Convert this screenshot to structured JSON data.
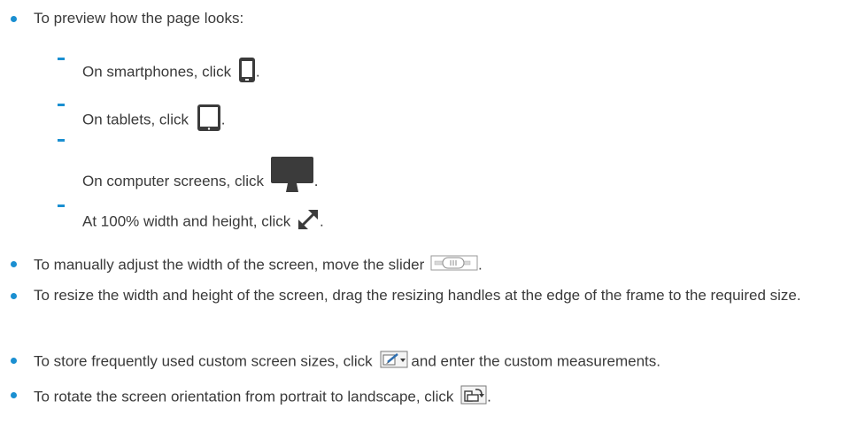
{
  "items": [
    {
      "text": "To preview how the page looks:"
    },
    {
      "text": "On smartphones, click",
      "suffix": ".",
      "icon": "smartphone-icon"
    },
    {
      "text": "On tablets, click",
      "suffix": ".",
      "icon": "tablet-icon"
    },
    {
      "text": "On computer screens, click",
      "suffix": ".",
      "icon": "desktop-monitor-icon"
    },
    {
      "text": "At 100% width and height, click",
      "suffix": ".",
      "icon": "expand-diagonal-icon"
    },
    {
      "text": "To manually adjust the width of the screen, move the slider",
      "suffix": ".",
      "icon": "slider-icon"
    },
    {
      "text": "To resize the width and height of the screen, drag the resizing handles at the edge of the frame to the required size."
    },
    {
      "text": "To store frequently used custom screen sizes, click",
      "suffix": "and enter the custom measurements.",
      "icon": "edit-dropdown-icon"
    },
    {
      "text": "To rotate the screen orientation from portrait to landscape, click",
      "suffix": ".",
      "icon": "rotate-orientation-icon"
    }
  ],
  "colors": {
    "bullet": "#1a8fd1",
    "icon_dark": "#3b3b3b",
    "text": "#3a3a3a"
  }
}
